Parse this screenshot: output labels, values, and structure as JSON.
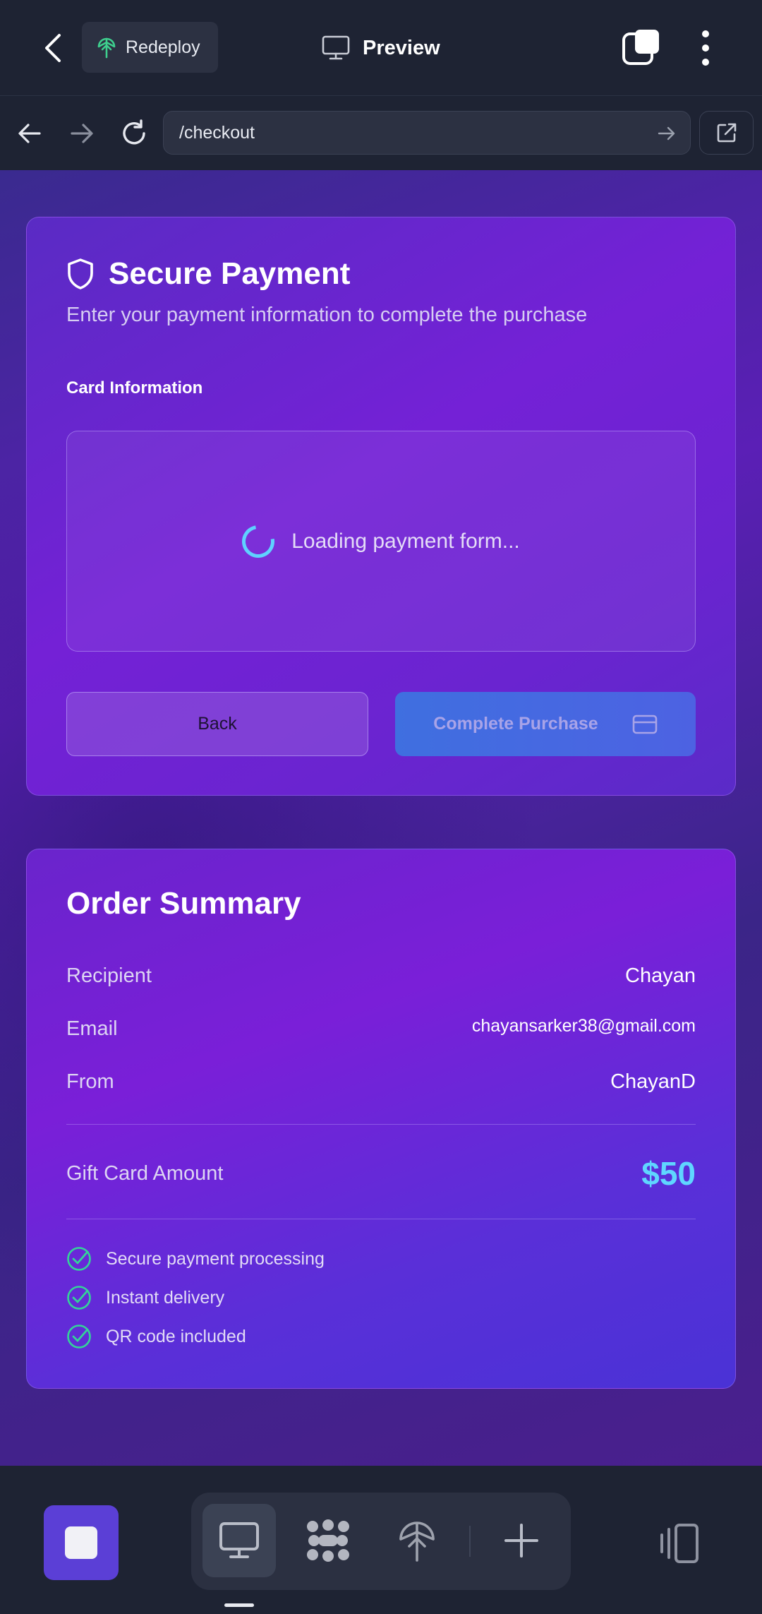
{
  "appbar": {
    "redeploy_label": "Redeploy",
    "title": "Preview"
  },
  "browser": {
    "url": "/checkout"
  },
  "payment": {
    "title": "Secure Payment",
    "subtitle": "Enter your payment information to complete the purchase",
    "card_info_label": "Card Information",
    "loading_text": "Loading payment form...",
    "back_label": "Back",
    "complete_label": "Complete Purchase"
  },
  "summary": {
    "title": "Order Summary",
    "rows": [
      {
        "label": "Recipient",
        "value": "Chayan"
      },
      {
        "label": "Email",
        "value": "chayansarker38@gmail.com"
      },
      {
        "label": "From",
        "value": "ChayanD"
      }
    ],
    "amount_label": "Gift Card Amount",
    "amount_value": "$50",
    "features": [
      "Secure payment processing",
      "Instant delivery",
      "QR code included"
    ]
  },
  "colors": {
    "accent_cyan": "#5fd6ff",
    "check_green": "#34d399",
    "stop_purple": "#5b3fd6"
  },
  "icons": [
    "back-chevron-icon",
    "redeploy-icon",
    "monitor-icon",
    "tabs-icon",
    "more-vert-icon",
    "arrow-left-icon",
    "arrow-right-icon",
    "refresh-icon",
    "go-arrow-icon",
    "external-link-icon",
    "shield-icon",
    "spinner-icon",
    "credit-card-icon",
    "check-circle-icon",
    "stop-icon",
    "monitor-icon",
    "apps-icon",
    "deploy-icon",
    "plus-icon",
    "panel-icon"
  ]
}
